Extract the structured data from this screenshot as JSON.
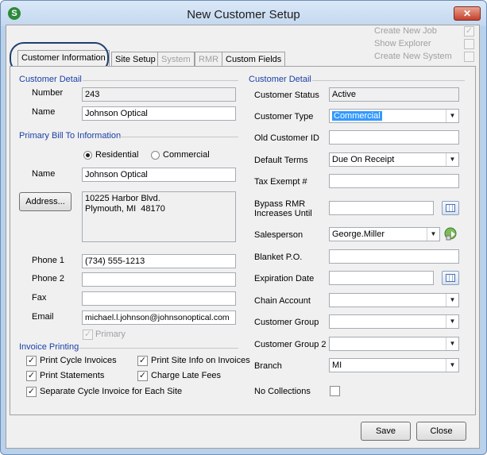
{
  "window": {
    "title": "New Customer Setup",
    "icon_letter": "S",
    "close_symbol": "✕"
  },
  "top_options": [
    {
      "label": "Create New Job",
      "checked": true
    },
    {
      "label": "Show Explorer",
      "checked": false
    },
    {
      "label": "Create New System",
      "checked": false
    }
  ],
  "tabs": [
    "Customer Information",
    "Site Setup",
    "System",
    "RMR",
    "Custom Fields"
  ],
  "left": {
    "detail_title": "Customer Detail",
    "number_label": "Number",
    "number_value": "243",
    "name_label": "Name",
    "name_value": "Johnson Optical",
    "billto_title": "Primary Bill To Information",
    "radio_residential": "Residential",
    "radio_commercial": "Commercial",
    "billto_name_label": "Name",
    "billto_name_value": "Johnson Optical",
    "address_button": "Address...",
    "address_value": "10225 Harbor Blvd.\nPlymouth, MI  48170",
    "phone1_label": "Phone 1",
    "phone1_value": "(734) 555-1213",
    "phone2_label": "Phone 2",
    "phone2_value": "",
    "fax_label": "Fax",
    "fax_value": "",
    "email_label": "Email",
    "email_value": "michael.l.johnson@johnsonoptical.com",
    "primary_label": "Primary",
    "primary_check": "✓",
    "invoice_title": "Invoice Printing",
    "print_cycle": "Print Cycle Invoices",
    "print_site": "Print Site Info on Invoices",
    "print_statements": "Print Statements",
    "charge_late": "Charge Late Fees",
    "separate_cycle": "Separate Cycle Invoice for Each Site",
    "check_mark": "✓"
  },
  "right": {
    "detail_title": "Customer Detail",
    "status_label": "Customer Status",
    "status_value": "Active",
    "type_label": "Customer Type",
    "type_value": "Commercial",
    "old_id_label": "Old Customer ID",
    "old_id_value": "",
    "terms_label": "Default Terms",
    "terms_value": "Due On Receipt",
    "tax_label": "Tax Exempt #",
    "tax_value": "",
    "bypass_label_1": "Bypass RMR",
    "bypass_label_2": "Increases Until",
    "bypass_value": "",
    "sales_label": "Salesperson",
    "sales_value": "George.Miller",
    "blanket_label": "Blanket P.O.",
    "blanket_value": "",
    "expiration_label": "Expiration Date",
    "expiration_value": "",
    "chain_label": "Chain Account",
    "chain_value": "",
    "group_label": "Customer Group",
    "group_value": "",
    "group2_label": "Customer Group 2",
    "group2_value": "",
    "branch_label": "Branch",
    "branch_value": "MI",
    "nocoll_label": "No Collections",
    "dropdown_arrow": "▼"
  },
  "buttons": {
    "save": "Save",
    "close": "Close"
  },
  "colors": {
    "section_blue": "#1b3fa6",
    "accent_ring": "#1f3f73",
    "selection": "#3399ff"
  }
}
